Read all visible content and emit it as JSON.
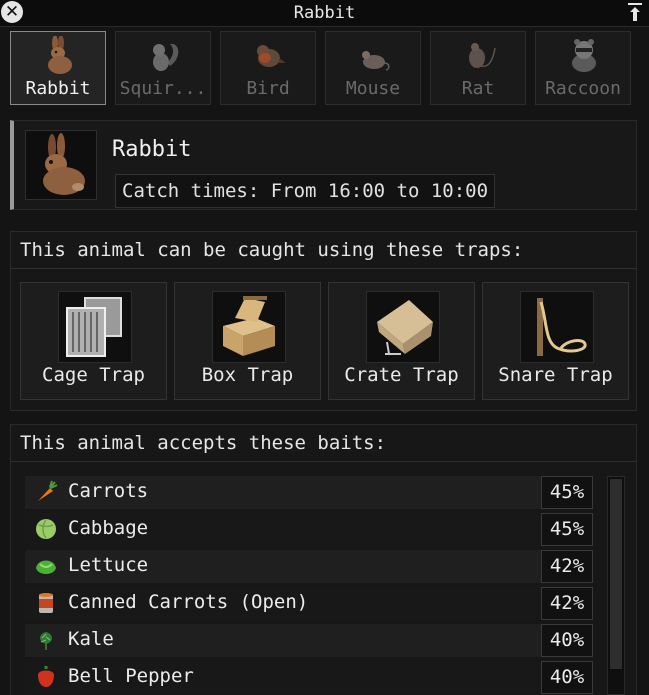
{
  "window": {
    "title": "Rabbit"
  },
  "tabs": [
    {
      "label": "Rabbit",
      "icon": "rabbit-icon",
      "active": true
    },
    {
      "label": "Squir...",
      "icon": "squirrel-icon",
      "active": false
    },
    {
      "label": "Bird",
      "icon": "bird-icon",
      "active": false
    },
    {
      "label": "Mouse",
      "icon": "mouse-icon",
      "active": false
    },
    {
      "label": "Rat",
      "icon": "rat-icon",
      "active": false
    },
    {
      "label": "Raccoon",
      "icon": "raccoon-icon",
      "active": false
    }
  ],
  "info": {
    "name": "Rabbit",
    "catch_times": "Catch times: From 16:00 to 10:00"
  },
  "traps": {
    "header": "This animal can be caught using these traps:",
    "items": [
      {
        "label": "Cage Trap",
        "icon": "cage-trap-icon"
      },
      {
        "label": "Box Trap",
        "icon": "box-trap-icon"
      },
      {
        "label": "Crate Trap",
        "icon": "crate-trap-icon"
      },
      {
        "label": "Snare Trap",
        "icon": "snare-trap-icon"
      }
    ]
  },
  "baits": {
    "header": "This animal accepts these baits:",
    "items": [
      {
        "name": "Carrots",
        "pct": "45%",
        "icon": "carrot-icon"
      },
      {
        "name": "Cabbage",
        "pct": "45%",
        "icon": "cabbage-icon"
      },
      {
        "name": "Lettuce",
        "pct": "42%",
        "icon": "lettuce-icon"
      },
      {
        "name": "Canned Carrots (Open)",
        "pct": "42%",
        "icon": "canned-carrots-icon"
      },
      {
        "name": "Kale",
        "pct": "40%",
        "icon": "kale-icon"
      },
      {
        "name": "Bell Pepper",
        "pct": "40%",
        "icon": "bell-pepper-icon"
      }
    ]
  }
}
